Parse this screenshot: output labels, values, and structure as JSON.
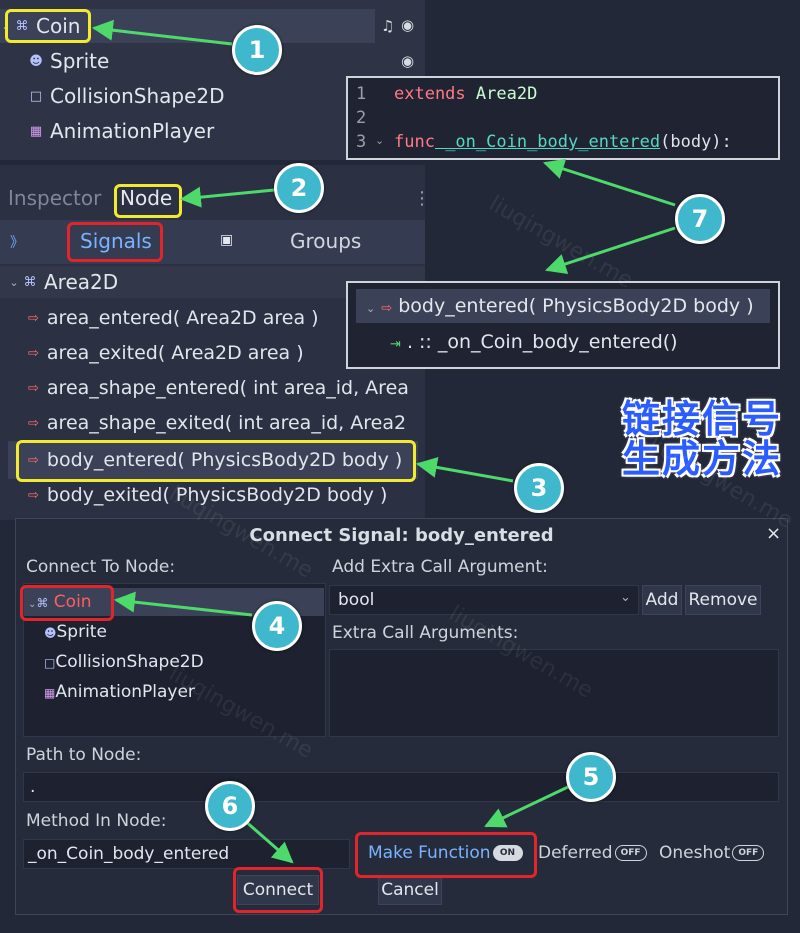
{
  "scene_tree": {
    "nodes": [
      {
        "name": "Coin",
        "icon": "area2d-icon"
      },
      {
        "name": "Sprite",
        "icon": "sprite-icon"
      },
      {
        "name": "CollisionShape2D",
        "icon": "collision-shape-icon"
      },
      {
        "name": "AnimationPlayer",
        "icon": "animation-player-icon"
      }
    ]
  },
  "inspector": {
    "tabs": [
      "Inspector",
      "Node"
    ],
    "sub_tabs": [
      "Signals",
      "Groups"
    ],
    "class_name": "Area2D",
    "signals": [
      "area_entered( Area2D area )",
      "area_exited( Area2D area )",
      "area_shape_entered( int area_id, Area",
      "area_shape_exited( int area_id, Area2",
      "body_entered( PhysicsBody2D body )",
      "body_exited( PhysicsBody2D body )"
    ]
  },
  "code": {
    "line_numbers": [
      "1",
      "2",
      "3"
    ],
    "line1_kw": "extends",
    "line1_rest": " Area2D",
    "line3_kw": "func",
    "line3_fn": " _on_Coin_body_entered",
    "line3_rest": "(body):"
  },
  "connection": {
    "signal": "body_entered( PhysicsBody2D body )",
    "target": ". :: _on_Coin_body_entered()"
  },
  "caption": {
    "line1": "链接信号",
    "line2": "生成方法"
  },
  "dialog": {
    "title": "Connect Signal: body_entered",
    "close": "×",
    "connect_to_node_label": "Connect To Node:",
    "nodes": [
      "Coin",
      "Sprite",
      "CollisionShape2D",
      "AnimationPlayer"
    ],
    "extra_arg_label": "Add Extra Call Argument:",
    "type_value": "bool",
    "add_label": "Add",
    "remove_label": "Remove",
    "extra_args_label": "Extra Call Arguments:",
    "path_label": "Path to Node:",
    "path_value": ".",
    "method_label": "Method In Node:",
    "method_value": "_on_Coin_body_entered",
    "make_function": "Make Function",
    "make_function_state": "ON",
    "deferred": "Deferred",
    "deferred_state": "OFF",
    "oneshot": "Oneshot",
    "oneshot_state": "OFF",
    "connect_label": "Connect",
    "cancel_label": "Cancel"
  },
  "annotations": [
    "1",
    "2",
    "3",
    "4",
    "5",
    "6",
    "7"
  ],
  "watermark": "liuqingwen.me",
  "colors": {
    "highlight_yellow": "#f2ea30",
    "highlight_red": "#e0262c",
    "badge": "#3fb7cc",
    "arrow": "#4ed96b",
    "caption_blue": "#2a5cff"
  }
}
